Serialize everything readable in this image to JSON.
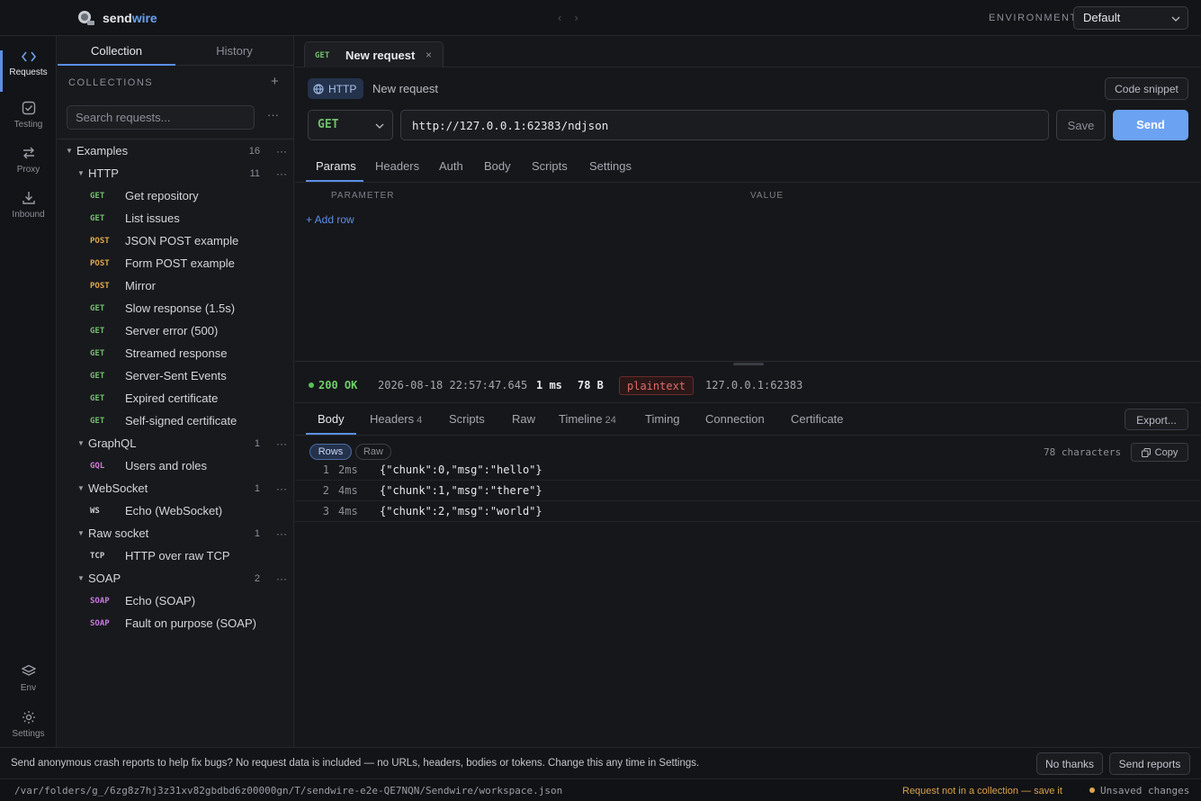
{
  "app": {
    "brand_prefix": "send",
    "brand_suffix": "wire",
    "environment_label": "ENVIRONMENT",
    "environment_value": "Default"
  },
  "rail": {
    "items": [
      {
        "label": "Requests",
        "icon": "code-brackets-icon",
        "active": true
      },
      {
        "label": "Testing",
        "icon": "checkbox-icon"
      },
      {
        "label": "Proxy",
        "icon": "swap-arrows-icon"
      },
      {
        "label": "Inbound",
        "icon": "download-icon"
      }
    ],
    "bottom": [
      {
        "label": "Env",
        "icon": "layers-icon"
      },
      {
        "label": "Settings",
        "icon": "gear-icon"
      }
    ]
  },
  "sidebar": {
    "tabs": [
      "Collection",
      "History"
    ],
    "collections_header": "COLLECTIONS",
    "add_symbol": "+",
    "search_placeholder": "Search requests...",
    "more_symbol": "···",
    "tree": {
      "root": {
        "name": "Examples",
        "count": "16"
      },
      "folders": [
        {
          "name": "HTTP",
          "count": "11",
          "requests": [
            {
              "method": "GET",
              "name": "Get repository"
            },
            {
              "method": "GET",
              "name": "List issues"
            },
            {
              "method": "POST",
              "name": "JSON POST example"
            },
            {
              "method": "POST",
              "name": "Form POST example"
            },
            {
              "method": "POST",
              "name": "Mirror"
            },
            {
              "method": "GET",
              "name": "Slow response (1.5s)"
            },
            {
              "method": "GET",
              "name": "Server error (500)"
            },
            {
              "method": "GET",
              "name": "Streamed response"
            },
            {
              "method": "GET",
              "name": "Server-Sent Events"
            },
            {
              "method": "GET",
              "name": "Expired certificate"
            },
            {
              "method": "GET",
              "name": "Self-signed certificate"
            }
          ]
        },
        {
          "name": "GraphQL",
          "count": "1",
          "requests": [
            {
              "method": "GQL",
              "name": "Users and roles"
            }
          ]
        },
        {
          "name": "WebSocket",
          "count": "1",
          "requests": [
            {
              "method": "WS",
              "name": "Echo (WebSocket)"
            }
          ]
        },
        {
          "name": "Raw socket",
          "count": "1",
          "requests": [
            {
              "method": "TCP",
              "name": "HTTP over raw TCP"
            }
          ]
        },
        {
          "name": "SOAP",
          "count": "2",
          "requests": [
            {
              "method": "SOAP",
              "name": "Echo (SOAP)"
            },
            {
              "method": "SOAP",
              "name": "Fault on purpose (SOAP)"
            }
          ]
        }
      ]
    }
  },
  "request": {
    "tab": {
      "method": "GET",
      "title": "New request",
      "close": "×"
    },
    "protocol": "HTTP",
    "name": "New request",
    "code_snippet": "Code snippet",
    "method": "GET",
    "url": "http://127.0.0.1:62383/ndjson",
    "save": "Save",
    "send": "Send",
    "tabs": [
      "Params",
      "Headers",
      "Auth",
      "Body",
      "Scripts",
      "Settings"
    ],
    "params_header": {
      "parameter": "PARAMETER",
      "value": "VALUE"
    },
    "add_row": "+ Add row"
  },
  "response": {
    "status": "200 OK",
    "timestamp": "2026-08-18 22:57:47.645",
    "duration": "1 ms",
    "size": "78 B",
    "content_type": "plaintext",
    "remote": "127.0.0.1:62383",
    "tabs": [
      {
        "label": "Body",
        "count": ""
      },
      {
        "label": "Headers",
        "count": "4"
      },
      {
        "label": "Scripts",
        "count": ""
      },
      {
        "label": "Raw",
        "count": ""
      },
      {
        "label": "Timeline",
        "count": "24"
      },
      {
        "label": "Timing",
        "count": ""
      },
      {
        "label": "Connection",
        "count": ""
      },
      {
        "label": "Certificate",
        "count": ""
      }
    ],
    "export": "Export...",
    "view_modes": [
      "Rows",
      "Raw"
    ],
    "characters": "78 characters",
    "copy": "Copy",
    "rows": [
      {
        "n": "1",
        "time": "2ms",
        "data": "{\"chunk\":0,\"msg\":\"hello\"}"
      },
      {
        "n": "2",
        "time": "4ms",
        "data": "{\"chunk\":1,\"msg\":\"there\"}"
      },
      {
        "n": "3",
        "time": "4ms",
        "data": "{\"chunk\":2,\"msg\":\"world\"}"
      }
    ]
  },
  "banner": {
    "text": "Send anonymous crash reports to help fix bugs? No request data is included — no URLs, headers, bodies or tokens. Change this any time in Settings.",
    "decline": "No thanks",
    "accept": "Send reports"
  },
  "footer": {
    "path": "/var/folders/g_/6zg8z7hj3z31xv82gbdbd6z00000gn/T/sendwire-e2e-QE7NQN/Sendwire/workspace.json",
    "warning": "Request not in a collection — save it",
    "unsaved": "Unsaved changes"
  },
  "colors": {
    "accent": "#6ca2f2",
    "get": "#6fbf6a",
    "post": "#e0a84a",
    "error_badge": "#e06a6a",
    "warning": "#d9a24a"
  }
}
